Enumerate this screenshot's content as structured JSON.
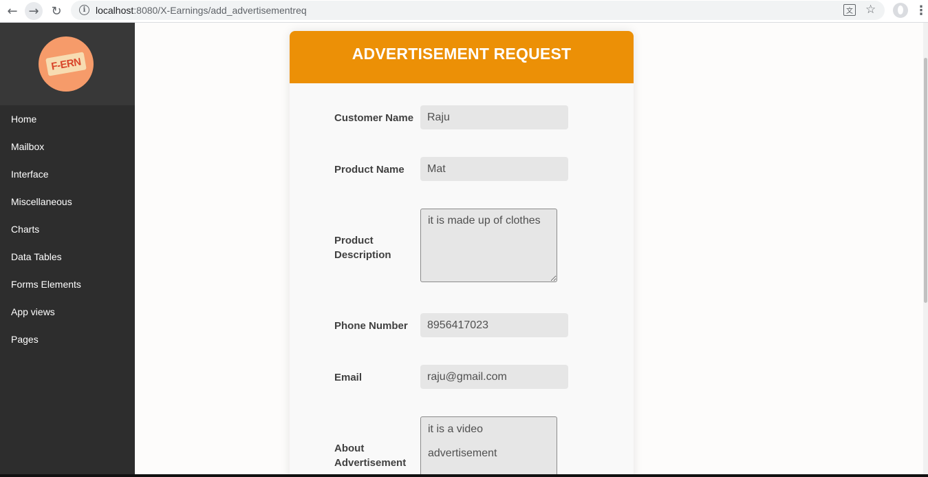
{
  "browser": {
    "url_host": "localhost",
    "url_path": ":8080/X-Earnings/add_advertisementreq"
  },
  "icons": {
    "back": "arrow-left",
    "forward": "arrow-right",
    "reload": "reload",
    "info": "info",
    "translate": "translate",
    "bookmark": "star",
    "profile": "profile",
    "menu": "more-vertical"
  },
  "sidebar": {
    "logo_text": "F-ERN",
    "items": [
      {
        "label": "Home"
      },
      {
        "label": "Mailbox"
      },
      {
        "label": "Interface"
      },
      {
        "label": "Miscellaneous"
      },
      {
        "label": "Charts"
      },
      {
        "label": "Data Tables"
      },
      {
        "label": "Forms Elements"
      },
      {
        "label": "App views"
      },
      {
        "label": "Pages"
      }
    ]
  },
  "form": {
    "title": "ADVERTISEMENT REQUEST",
    "customer_name": {
      "label": "Customer Name",
      "value": "Raju"
    },
    "product_name": {
      "label": "Product Name",
      "value": "Mat"
    },
    "product_description": {
      "label_line1": "Product",
      "label_line2": "Description",
      "value": "it is made up of clothes"
    },
    "phone_number": {
      "label": "Phone Number",
      "value": "8956417023"
    },
    "email": {
      "label": "Email",
      "value": "raju@gmail.com"
    },
    "about_advertisement": {
      "label_line1": "About",
      "label_line2": "Advertisement",
      "value": "it is a video advertisement"
    }
  },
  "colors": {
    "header": "#ec9006",
    "sidebar": "#2d2d2d",
    "logo_bg": "#f69b6a"
  }
}
